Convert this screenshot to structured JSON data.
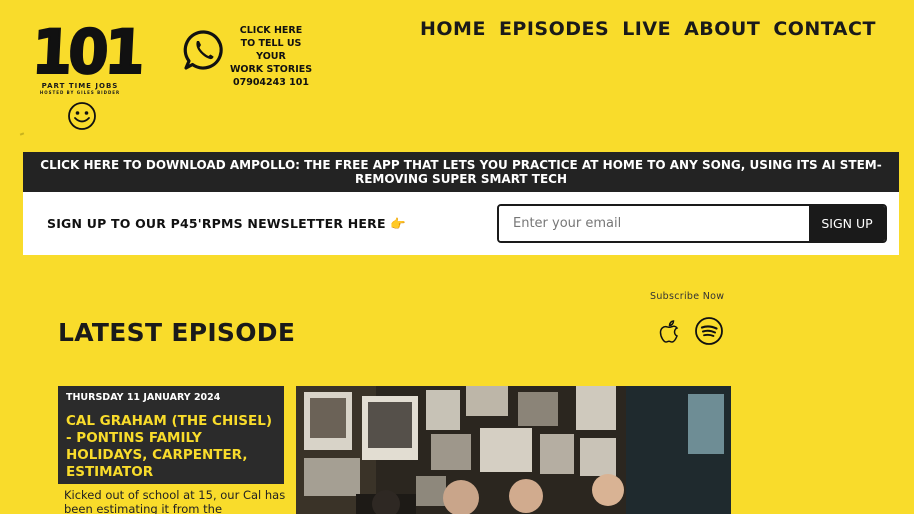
{
  "logo": {
    "text": "101",
    "subtitle": "PART TIME JOBS",
    "hosted": "HOSTED BY GILES BIDDER"
  },
  "whatsapp": {
    "line1": "CLICK HERE",
    "line2": "TO TELL US YOUR",
    "line3": "WORK STORIES",
    "phone": "07904243 101"
  },
  "nav": [
    "HOME",
    "EPISODES",
    "LIVE",
    "ABOUT",
    "CONTACT"
  ],
  "banner": "CLICK HERE TO DOWNLOAD AMPOLLO: THE FREE APP THAT LETS YOU PRACTICE AT HOME TO ANY SONG, USING ITS AI STEM-REMOVING SUPER SMART TECH",
  "newsletter": {
    "label": "SIGN UP TO OUR P45'RPMS NEWSLETTER HERE",
    "emoji": "👉",
    "placeholder": "Enter your email",
    "button": "SIGN UP"
  },
  "subscribe": {
    "label": "Subscribe Now",
    "icons": [
      "apple-podcasts-icon",
      "spotify-icon"
    ]
  },
  "latest": {
    "heading": "LATEST EPISODE"
  },
  "episode": {
    "date": "THURSDAY 11 JANUARY 2024",
    "title": "CAL GRAHAM (THE CHISEL) - PONTINS FAMILY HOLIDAYS, CARPENTER, ESTIMATOR",
    "description": "Kicked out of school at 15, our Cal has been estimating it from the"
  },
  "colors": {
    "background": "#f9dc2b",
    "dark": "#232323",
    "accent": "#f9dc2b"
  }
}
